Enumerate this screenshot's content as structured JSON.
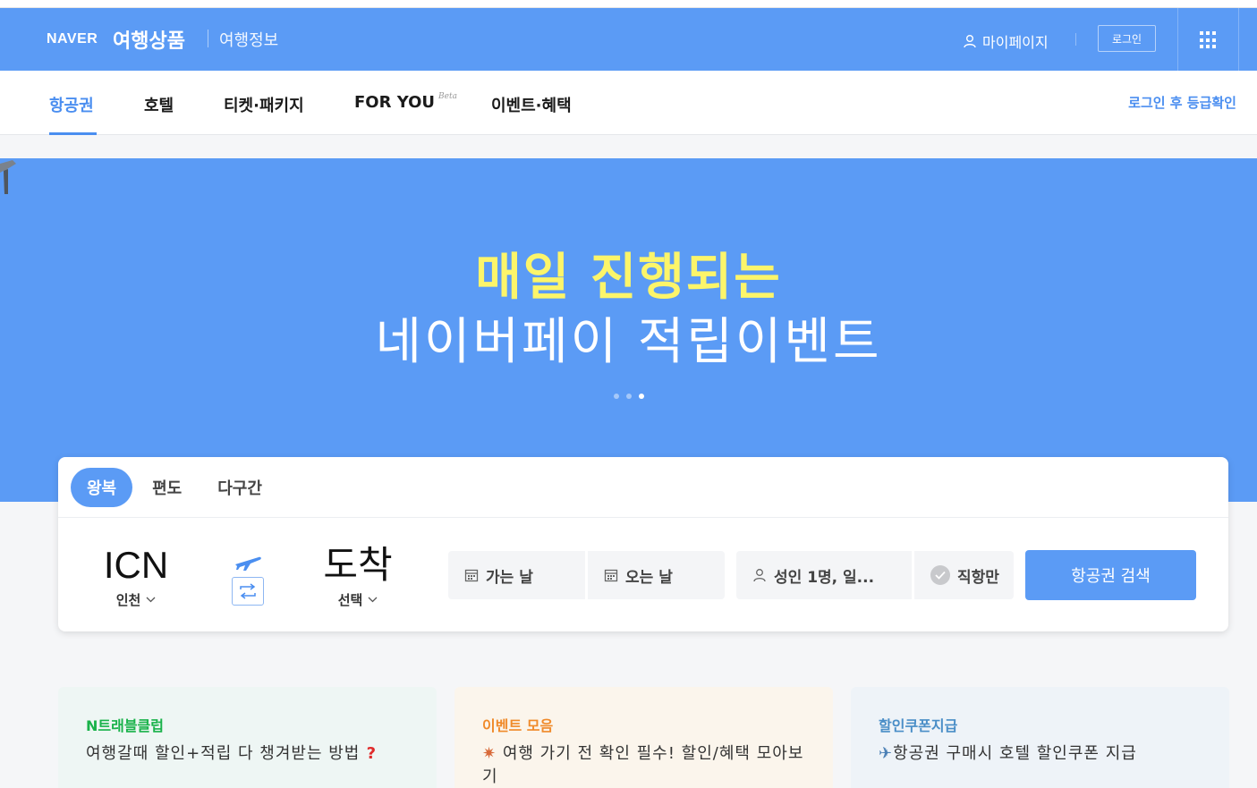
{
  "header": {
    "brand": "NAVER",
    "title": "여행상품",
    "subtitle": "여행정보",
    "mypage_label": "마이페이지",
    "login_label": "로그인",
    "apps_icon": "grid-icon"
  },
  "nav": {
    "items": [
      {
        "label": "항공권",
        "active": true
      },
      {
        "label": "호텔"
      },
      {
        "label": "티켓·패키지"
      },
      {
        "label": "FOR YOU",
        "badge": "Beta"
      },
      {
        "label": "이벤트·혜택"
      }
    ],
    "right_link": "로그인 후 등급확인"
  },
  "hero": {
    "line1": "매일 진행되는",
    "line2": "네이버페이 적립이벤트",
    "active_slide": 3,
    "slide_count": 3,
    "colors": {
      "background": "#5b9bf5",
      "highlight": "#fcf56a"
    }
  },
  "search": {
    "trip_tabs": [
      "왕복",
      "편도",
      "다구간"
    ],
    "active_tab": "왕복",
    "origin": {
      "code": "ICN",
      "name": "인천"
    },
    "destination": {
      "code": "도착",
      "name": "선택"
    },
    "depart_label": "가는 날",
    "return_label": "오는 날",
    "passengers_label": "성인 1명, 일...",
    "nonstop_label": "직항만",
    "search_button": "항공권 검색"
  },
  "promos": [
    {
      "title": "N트래블클럽",
      "text": "여행갈때 할인+적립 다 챙겨받는 방법",
      "icon": "question-icon"
    },
    {
      "title": "이벤트 모음",
      "text": "여행 가기 전 확인 필수! 할인/혜택 모아보기",
      "icon": "party-icon"
    },
    {
      "title": "할인쿠폰지급",
      "text": "항공권 구매시 호텔 할인쿠폰 지급",
      "icon": "airplane-icon"
    }
  ]
}
